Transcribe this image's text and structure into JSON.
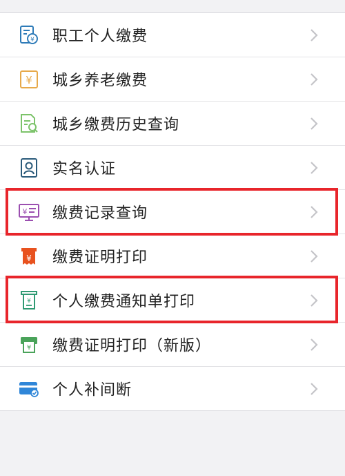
{
  "menu": {
    "items": [
      {
        "label": "职工个人缴费",
        "icon": "employee-payment-icon",
        "color": "#2e7bb8"
      },
      {
        "label": "城乡养老缴费",
        "icon": "yuan-pension-icon",
        "color": "#e7a94a"
      },
      {
        "label": "城乡缴费历史查询",
        "icon": "document-search-icon",
        "color": "#7cc36a"
      },
      {
        "label": "实名认证",
        "icon": "id-verify-icon",
        "color": "#2a5a7a"
      },
      {
        "label": "缴费记录查询",
        "icon": "payment-record-icon",
        "color": "#9b4fb0"
      },
      {
        "label": "缴费证明打印",
        "icon": "receipt-print-icon",
        "color": "#e8521f"
      },
      {
        "label": "个人缴费通知单打印",
        "icon": "notice-print-icon",
        "color": "#2f9a73"
      },
      {
        "label": "缴费证明打印（新版）",
        "icon": "new-receipt-print-icon",
        "color": "#4aa35a"
      },
      {
        "label": "个人补间断",
        "icon": "card-icon",
        "color": "#2f86d8"
      }
    ]
  },
  "highlight": {
    "color": "#e8252b"
  }
}
